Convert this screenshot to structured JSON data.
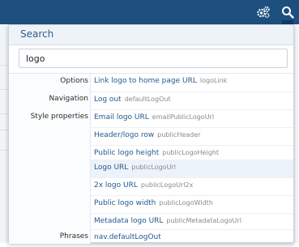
{
  "topbar": {
    "icons": [
      "gears-icon",
      "search-icon"
    ]
  },
  "panel": {
    "title": "Search",
    "query": "logo"
  },
  "groups": {
    "options": "Options",
    "navigation": "Navigation",
    "style_properties": "Style properties",
    "phrases": "Phrases"
  },
  "results": {
    "options": [
      {
        "title": "Link logo to home page URL",
        "key": "logoLink"
      }
    ],
    "navigation": [
      {
        "title": "Log out",
        "key": "defaultLogOut"
      }
    ],
    "style_properties": [
      {
        "title": "Email logo URL",
        "key": "emailPublicLogoUrl"
      },
      {
        "title": "Header/logo row",
        "key": "publicHeader"
      },
      {
        "title": "Public logo height",
        "key": "publicLogoHeight"
      },
      {
        "title": "Logo URL",
        "key": "publicLogoUrl"
      },
      {
        "title": "2x logo URL",
        "key": "publicLogoUrl2x"
      },
      {
        "title": "Public logo width",
        "key": "publicLogoWidth"
      },
      {
        "title": "Metadata logo URL",
        "key": "publicMetadataLogoUrl"
      }
    ],
    "phrases": [
      {
        "title": "nav.defaultLogOut",
        "key": ""
      }
    ]
  },
  "colors": {
    "topbar": "#1c4e7e",
    "link": "#1f5a91",
    "highlight": "#edf3fa"
  }
}
